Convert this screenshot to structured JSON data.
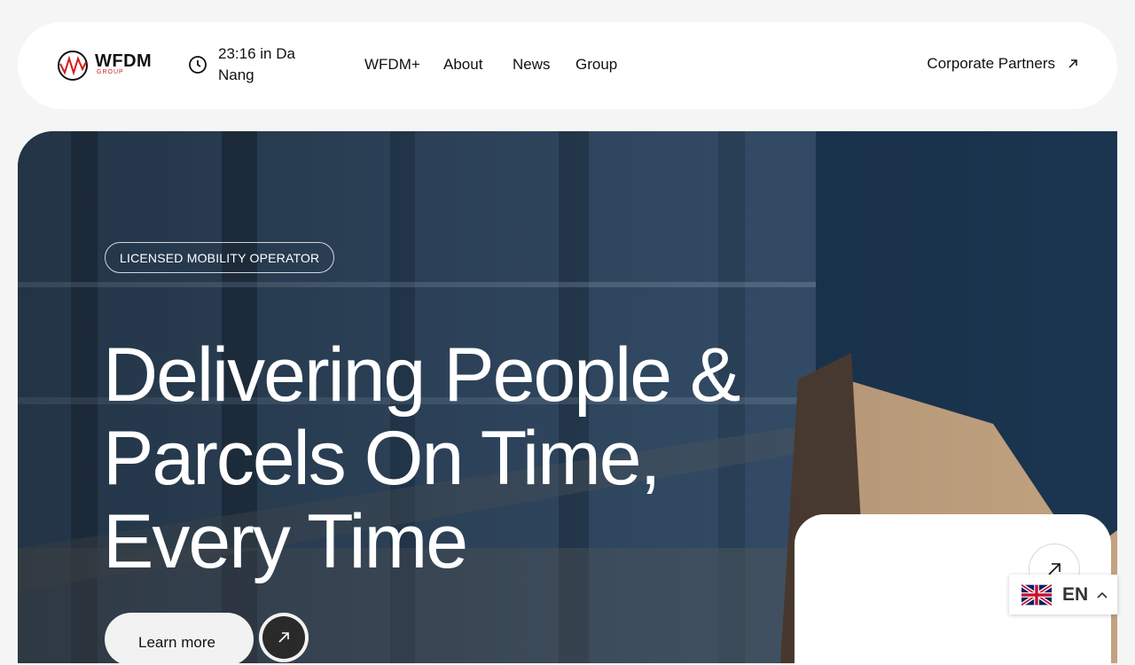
{
  "brand": {
    "name": "WFDM",
    "sub": "GROUP",
    "accent": "#d41b1b"
  },
  "header": {
    "time_text": "23:16 in Da Nang",
    "nav": [
      "WFDM+",
      "About",
      "News",
      "Group"
    ],
    "partners_label": "Corporate Partners"
  },
  "hero": {
    "badge": "LICENSED MOBILITY OPERATOR",
    "headline": "Delivering People & Parcels On Time, Every Time",
    "cta_label": "Learn more"
  },
  "language": {
    "code": "EN",
    "flag": "uk-flag-icon"
  }
}
